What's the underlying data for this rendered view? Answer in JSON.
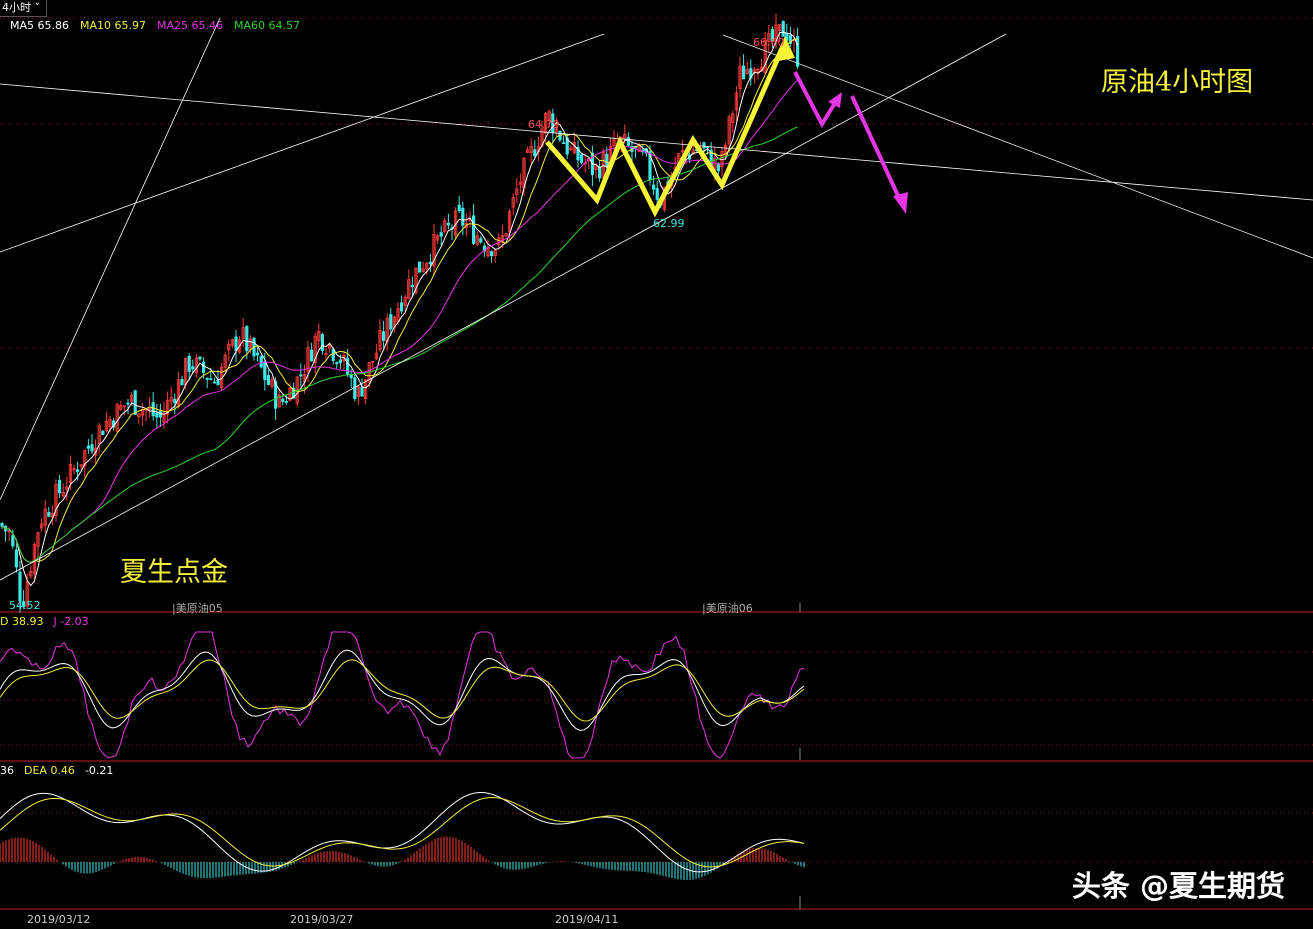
{
  "header": {
    "period_label": "4小时",
    "chevron_icon": "chevron-down-icon"
  },
  "price_panel": {
    "ma_legend": [
      {
        "label": "MA5 65.86",
        "color": "#ffffff"
      },
      {
        "label": "MA10 65.97",
        "color": "#f2ef3b"
      },
      {
        "label": "MA25 65.46",
        "color": "#e535e5"
      },
      {
        "label": "MA60 64.57",
        "color": "#2ed22e"
      }
    ],
    "title_annotation": "原油4小时图",
    "author_annotation": "夏生点金",
    "high_label": "66.60",
    "mid_high_label": "64.79",
    "low_label": "62.99",
    "start_low_label": "54.52",
    "contract_labels": [
      "|美原油05",
      "|美原油06"
    ]
  },
  "kdj_panel": {
    "labels": [
      {
        "text": "D 38.93",
        "color": "#f2ef3b"
      },
      {
        "text": "J -2.03",
        "color": "#e535e5"
      }
    ]
  },
  "macd_panel": {
    "labels": [
      {
        "text": "36",
        "color": "#ffffff"
      },
      {
        "text": "DEA 0.46",
        "color": "#f2ef3b"
      },
      {
        "text": "-0.21",
        "color": "#ffffff"
      }
    ]
  },
  "dates": [
    "2019/03/12",
    "2019/03/27",
    "2019/04/11"
  ],
  "watermark": "头条 @夏生期货",
  "colors": {
    "up_candle": "#ff3b3b",
    "down_candle": "#3ee6e6",
    "grid": "#8a1a1a",
    "trend_line": "#ffffff",
    "yellow_arrow": "#f5f536",
    "magenta_arrow": "#e535e5"
  },
  "chart_data": {
    "type": "candlestick",
    "ylim": [
      54.4,
      66.8
    ],
    "key_prices": {
      "high": 66.6,
      "pivot": 64.79,
      "low": 62.99,
      "start": 54.52
    },
    "series": [
      {
        "name": "MA5",
        "last": 65.86
      },
      {
        "name": "MA10",
        "last": 65.97
      },
      {
        "name": "MA25",
        "last": 65.46
      },
      {
        "name": "MA60",
        "last": 64.57
      }
    ],
    "indicators": {
      "KDJ": {
        "D": 38.93,
        "J": -2.03
      },
      "MACD": {
        "DEA": 0.46,
        "hist": -0.21
      }
    },
    "x_ticks": [
      "2019/03/12",
      "2019/03/27",
      "2019/04/11"
    ]
  }
}
